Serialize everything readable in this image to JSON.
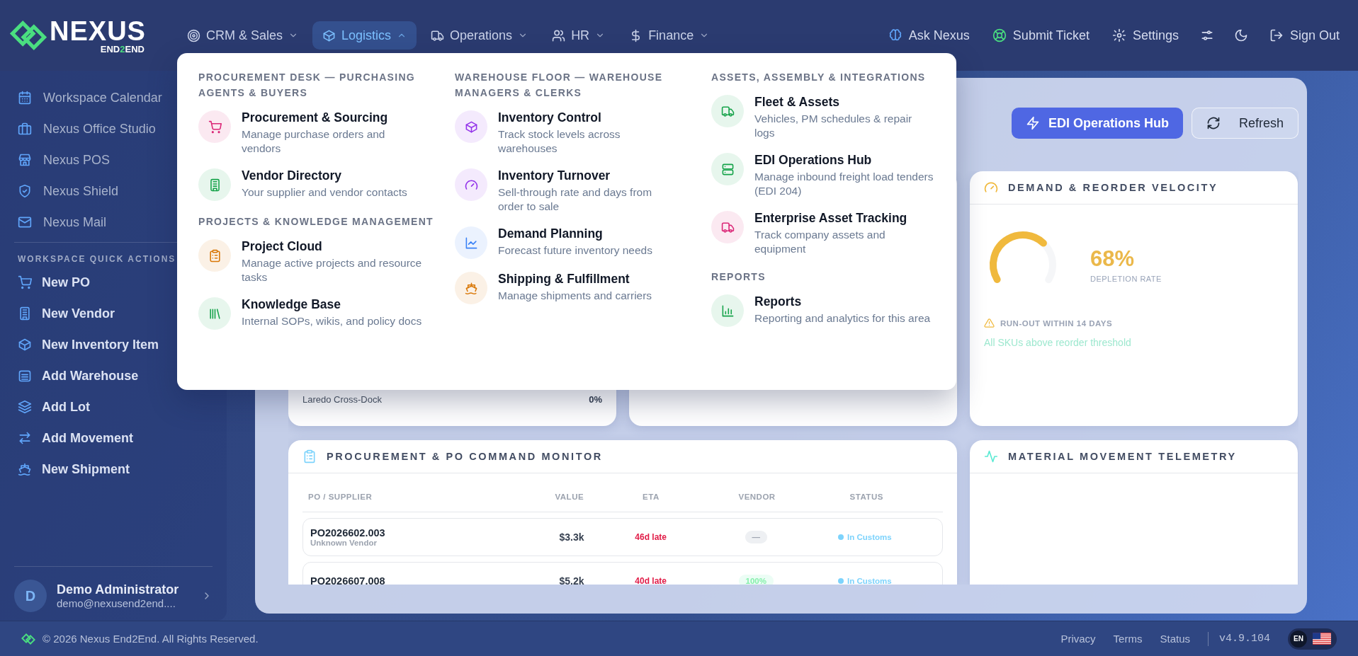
{
  "logo": {
    "name": "NEXUS",
    "sub": "END**2**END"
  },
  "nav": [
    {
      "label": "CRM & Sales",
      "selected": false,
      "expanded": false
    },
    {
      "label": "Logistics",
      "selected": true,
      "expanded": true
    },
    {
      "label": "Operations",
      "selected": false,
      "expanded": false
    },
    {
      "label": "HR",
      "selected": false,
      "expanded": false
    },
    {
      "label": "Finance",
      "selected": false,
      "expanded": false
    }
  ],
  "nav_actions": [
    "Ask Nexus",
    "Submit Ticket",
    "Settings"
  ],
  "sign_out": "Sign Out",
  "menu": {
    "columns": [
      {
        "groups": [
          {
            "heading": "PROCUREMENT DESK — PURCHASING AGENTS & BUYERS",
            "items": [
              {
                "title": "Procurement & Sourcing",
                "desc": "Manage purchase orders and vendors",
                "color": "#db2777"
              },
              {
                "title": "Vendor Directory",
                "desc": "Your supplier and vendor contacts",
                "color": "#16a34a"
              }
            ]
          },
          {
            "heading": "PROJECTS & KNOWLEDGE MANAGEMENT",
            "items": [
              {
                "title": "Project Cloud",
                "desc": "Manage active projects and resource tasks",
                "color": "#d97706"
              },
              {
                "title": "Knowledge Base",
                "desc": "Internal SOPs, wikis, and policy docs",
                "color": "#16a34a"
              }
            ]
          }
        ]
      },
      {
        "groups": [
          {
            "heading": "WAREHOUSE FLOOR — WAREHOUSE MANAGERS & CLERKS",
            "items": [
              {
                "title": "Inventory Control",
                "desc": "Track stock levels across warehouses",
                "color": "#9333ea"
              },
              {
                "title": "Inventory Turnover",
                "desc": "Sell-through rate and days from order to sale",
                "color": "#9333ea"
              },
              {
                "title": "Demand Planning",
                "desc": "Forecast future inventory needs",
                "color": "#3b82f6"
              },
              {
                "title": "Shipping & Fulfillment",
                "desc": "Manage shipments and carriers",
                "color": "#d97706"
              }
            ]
          }
        ]
      },
      {
        "groups": [
          {
            "heading": "ASSETS, ASSEMBLY & INTEGRATIONS",
            "items": [
              {
                "title": "Fleet & Assets",
                "desc": "Vehicles, PM schedules & repair logs",
                "color": "#16a34a"
              },
              {
                "title": "EDI Operations Hub",
                "desc": "Manage inbound freight load tenders (EDI 204)",
                "color": "#16a34a"
              },
              {
                "title": "Enterprise Asset Tracking",
                "desc": "Track company assets and equipment",
                "color": "#db2777"
              }
            ]
          },
          {
            "heading": "REPORTS",
            "items": [
              {
                "title": "Reports",
                "desc": "Reporting and analytics for this area",
                "color": "#16a34a"
              }
            ]
          }
        ]
      }
    ]
  },
  "sidebar": {
    "apps": [
      "Workspace Calendar",
      "Nexus Office Studio",
      "Nexus POS",
      "Nexus Shield",
      "Nexus Mail"
    ],
    "quick_heading": "WORKSPACE QUICK ACTIONS",
    "quick_actions": [
      "New PO",
      "New Vendor",
      "New Inventory Item",
      "Add Warehouse",
      "Add Lot",
      "Add Movement",
      "New Shipment"
    ],
    "user": {
      "initial": "D",
      "name": "Demo Administrator",
      "email": "demo@nexusend2end...."
    }
  },
  "toolbar": {
    "primary": "EDI Operations Hub",
    "secondary": "Refresh"
  },
  "warehouse_card": {
    "rows": [
      {
        "name": "Laredo Cross-Dock",
        "value": "0%"
      }
    ]
  },
  "demand_card": {
    "title": "DEMAND & REORDER VELOCITY",
    "gauge": {
      "level": 0.68
    },
    "value": "68%",
    "caption": "DEPLETION RATE",
    "warning": "RUN-OUT WITHIN 14 DAYS",
    "note": "All SKUs above reorder threshold"
  },
  "po_card": {
    "title": "PROCUREMENT & PO COMMAND MONITOR",
    "columns": [
      "PO / SUPPLIER",
      "VALUE",
      "ETA",
      "VENDOR",
      "STATUS"
    ],
    "rows": [
      {
        "po": "PO2026602.003",
        "supplier": "Unknown Vendor",
        "value": "$3.3k",
        "eta": "46d late",
        "vendor": {
          "kind": "empty",
          "text": "—"
        },
        "status": {
          "text": "In Customs",
          "color": "#7dd3fc"
        }
      },
      {
        "po": "PO2026607.008",
        "value": "$5.2k",
        "eta": "40d late",
        "vendor": {
          "kind": "score",
          "text": "100%"
        },
        "status": {
          "text": "In Customs",
          "color": "#7dd3fc"
        }
      }
    ]
  },
  "telemetry_card": {
    "title": "MATERIAL MOVEMENT TELEMETRY"
  },
  "footer": {
    "copyright": "© 2026 Nexus End2End. All Rights Reserved.",
    "links": [
      "Privacy",
      "Terms",
      "Status"
    ],
    "version": "v4.9.104",
    "language": "EN"
  }
}
